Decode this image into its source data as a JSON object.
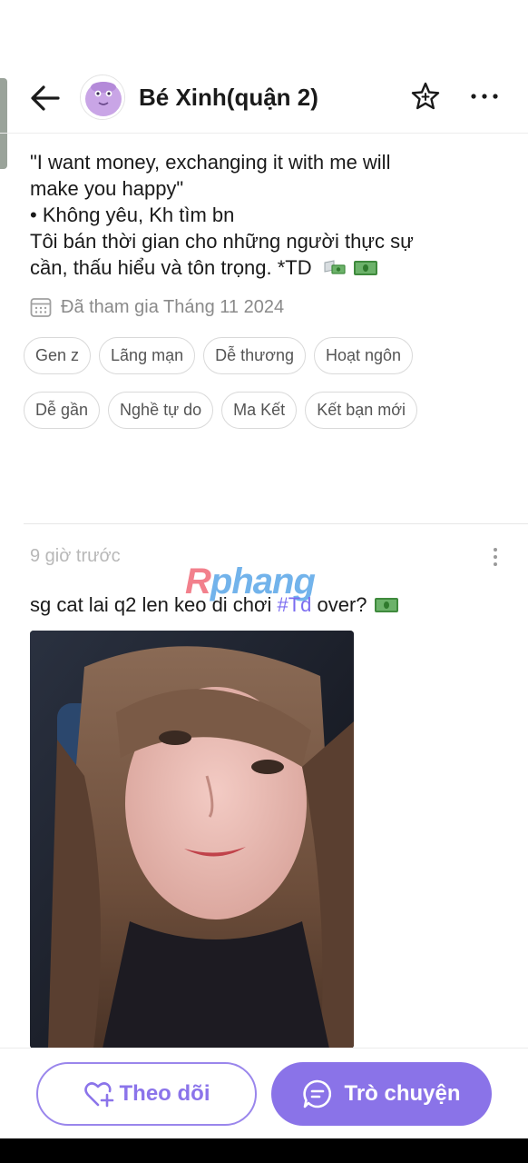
{
  "header": {
    "title": "Bé Xinh(quận 2)",
    "icons": {
      "back": "arrow-left-icon",
      "favorite": "star-add-icon",
      "more": "more-horizontal-icon"
    }
  },
  "bio": {
    "lines": [
      "\"I want money, exchanging it with me will",
      "make you happy\"",
      "• Không yêu, Kh tìm bn",
      "Tôi bán thời gian cho những người thực sự",
      "cần, thấu hiểu và tôn trọng. *TD"
    ],
    "emoji": [
      "money-with-wings-icon",
      "dollar-banknote-icon"
    ]
  },
  "joined": {
    "text": "Đã tham gia Tháng 11 2024",
    "icon": "calendar-icon"
  },
  "tags": {
    "row1": [
      "Gen z",
      "Lãng mạn",
      "Dễ thương",
      "Hoạt ngôn"
    ],
    "row2": [
      "Dễ gần",
      "Nghề tự do",
      "Ma Kết",
      "Kết bạn mới"
    ]
  },
  "post": {
    "time": "9 giờ trước",
    "text_before": "sg cat lai q2 len keo di chơi ",
    "hashtag": "#Td",
    "text_after": " over?",
    "emoji": "dollar-banknote-icon"
  },
  "watermark": {
    "part1": "R",
    "part2": "phang"
  },
  "actions": {
    "follow_label": "Theo dõi",
    "chat_label": "Trò chuyện"
  },
  "colors": {
    "accent": "#8a73e8",
    "hashtag": "#7b6cf0",
    "muted_text": "#8a8a8a",
    "tag_border": "#d9d9d9"
  }
}
